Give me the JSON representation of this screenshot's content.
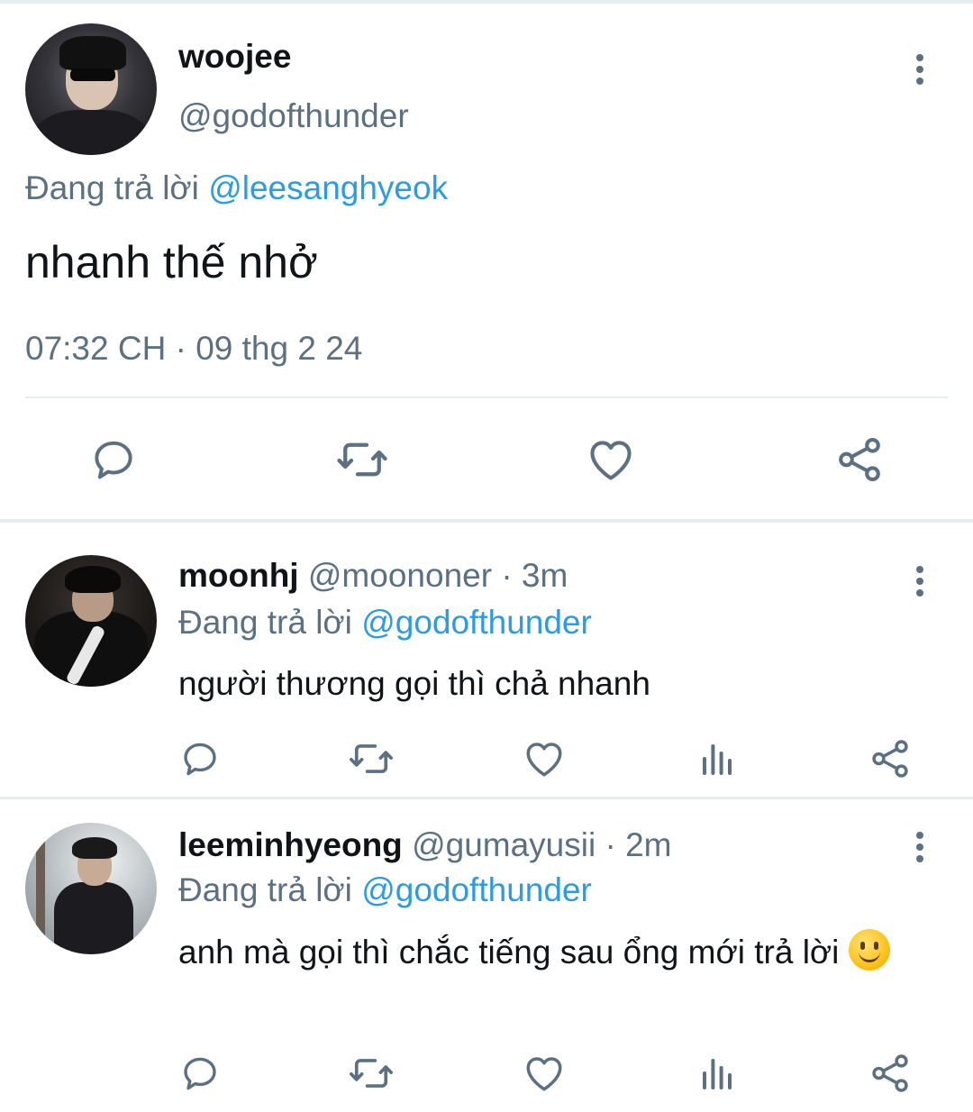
{
  "main_tweet": {
    "name": "woojee",
    "handle": "@godofthunder",
    "replying_prefix": "Đang trả lời",
    "replying_to": "@leesanghyeok",
    "text": "nhanh thế nhở",
    "timestamp": "07:32 CH · 09 thg 2 24",
    "actions": [
      "reply-icon",
      "retweet-icon",
      "like-icon",
      "share-icon"
    ]
  },
  "replies": [
    {
      "name": "moonhj",
      "handle": "@moononer",
      "time": "· 3m",
      "replying_prefix": "Đang trả lời",
      "replying_to": "@godofthunder",
      "text": "người thương gọi thì chả nhanh",
      "actions": [
        "reply-icon",
        "retweet-icon",
        "like-icon",
        "analytics-icon",
        "share-icon"
      ]
    },
    {
      "name": "leeminhyeong",
      "handle": "@gumayusii",
      "time": "· 2m",
      "replying_prefix": "Đang trả lời",
      "replying_to": "@godofthunder",
      "text": "anh mà gọi thì chắc tiếng sau ổng mới trả lời",
      "emoji": "slightly-smiling-face",
      "actions": [
        "reply-icon",
        "retweet-icon",
        "like-icon",
        "analytics-icon",
        "share-icon"
      ]
    }
  ],
  "colors": {
    "secondary_text": "#5b7083",
    "link": "#2b9be6",
    "divider": "#e6ecf0",
    "icon": "#5b7083"
  }
}
